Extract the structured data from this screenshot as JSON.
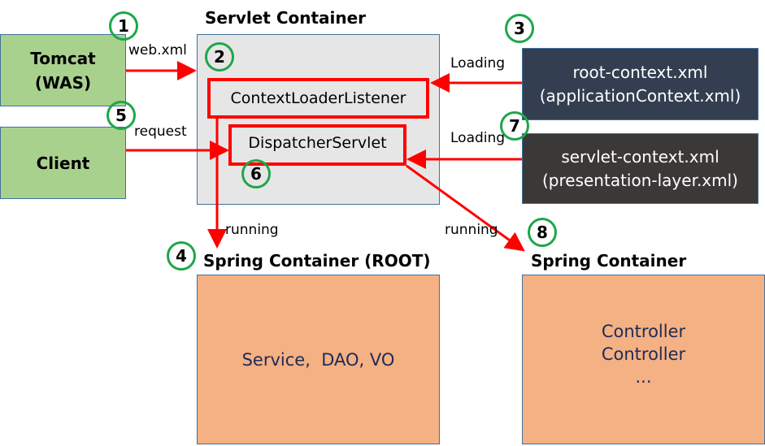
{
  "servlet_container": {
    "title": "Servlet Container",
    "context_loader_listener": "ContextLoaderListener",
    "dispatcher_servlet": "DispatcherServlet"
  },
  "tomcat": {
    "line1": "Tomcat",
    "line2": "(WAS)"
  },
  "client": {
    "label": "Client"
  },
  "root_context": {
    "line1": "root-context.xml",
    "line2": "(applicationContext.xml)"
  },
  "servlet_context": {
    "line1": "servlet-context.xml",
    "line2": "(presentation-layer.xml)"
  },
  "spring_root": {
    "title": "Spring Container (ROOT)",
    "content": "Service,  DAO, VO"
  },
  "spring_web": {
    "title": "Spring Container",
    "lines": [
      "Controller",
      "Controller",
      "..."
    ]
  },
  "edge_labels": {
    "web_xml": "web.xml",
    "request": "request",
    "loading_root": "Loading",
    "loading_servlet": "Loading",
    "running_root": "running",
    "running_web": "running"
  },
  "step_numbers": [
    "1",
    "2",
    "3",
    "4",
    "5",
    "6",
    "7",
    "8"
  ],
  "colors": {
    "arrow": "#ff0000",
    "step_circle": "#1fa64a",
    "green_box": "#a9d18e",
    "orange_box": "#f4b183"
  }
}
